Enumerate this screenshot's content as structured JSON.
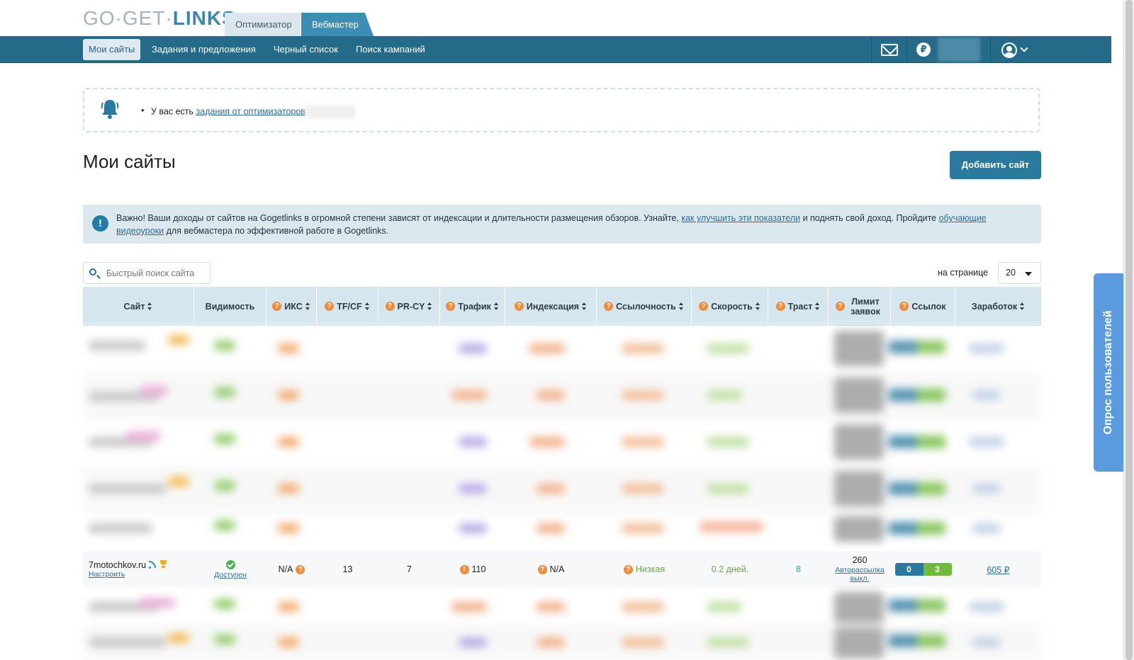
{
  "header": {
    "logo": {
      "part1": "GO·GET·",
      "part2": "LINKS"
    },
    "tabs": [
      {
        "label": "Оптимизатор"
      },
      {
        "label": "Вебмастер"
      }
    ],
    "nav": [
      {
        "label": "Мои сайты"
      },
      {
        "label": "Задания и предложения"
      },
      {
        "label": "Черный список"
      },
      {
        "label": "Поиск кампаний"
      }
    ],
    "currency_symbol": "₽"
  },
  "notice": {
    "prefix": "У вас есть ",
    "link": "задания от оптимизаторов"
  },
  "page": {
    "title": "Мои сайты",
    "add_button": "Добавить сайт"
  },
  "info": {
    "icon": "!",
    "text1": "Важно! Ваши доходы от сайтов на Gogetlinks в огромной степени зависят от индексации и длительности размещения обзоров. Узнайте, ",
    "link1": "как улучшить эти показатели",
    "text2": " и поднять свой доход. Пройдите ",
    "link2": "обучающие видеоуроки",
    "text3": " для вебмастера по эффективной работе в Gogetlinks."
  },
  "controls": {
    "search_placeholder": "Быстрый поиск сайта",
    "per_page_label": "на странице",
    "per_page_value": "20"
  },
  "table": {
    "columns": [
      "Сайт",
      "Видимость",
      "ИКС",
      "TF/CF",
      "PR-CY",
      "Трафик",
      "Индексация",
      "Ссылочность",
      "Скорость",
      "Траст",
      "Лимит заявок",
      "Ссылок",
      "Заработок"
    ],
    "row": {
      "site": "7motochkov.ru",
      "configure": "Настроить",
      "visibility": "Доступен",
      "iks": "N/A",
      "tfcf": "13",
      "prcy": "7",
      "traffic": "110",
      "indexation": "N/A",
      "linkiness": "Низкая",
      "speed": "0.2 дней.",
      "trust": "8",
      "limit": "260",
      "limit_note": "Авторассылка выкл.",
      "links_a": "0",
      "links_b": "3",
      "earnings": "605 ₽"
    }
  },
  "survey": {
    "label": "Опрос пользователей"
  },
  "colors": {
    "brand": "#246b89",
    "accent": "#2a7aa0",
    "warning": "#ef8b3a",
    "success": "#6fbb3c"
  }
}
